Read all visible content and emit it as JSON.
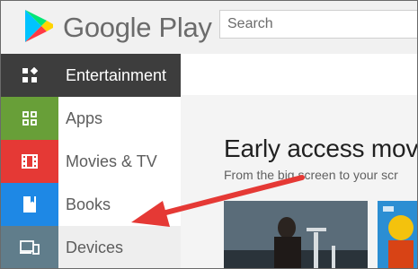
{
  "header": {
    "brand": "Google Play",
    "search_placeholder": "Search"
  },
  "sidebar": {
    "items": [
      {
        "label": "Entertainment",
        "icon": "grid-icon",
        "selected": true
      },
      {
        "label": "Apps",
        "icon": "apps-grid-icon",
        "color": "#689f38"
      },
      {
        "label": "Movies & TV",
        "icon": "film-icon",
        "color": "#e53935"
      },
      {
        "label": "Books",
        "icon": "book-icon",
        "color": "#1e88e5"
      },
      {
        "label": "Devices",
        "icon": "devices-icon",
        "color": "#607d8b"
      }
    ]
  },
  "main": {
    "title": "Early access mov",
    "subtitle": "From the big screen to your scr",
    "cards": [
      {
        "icon": "movie-poster"
      },
      {
        "icon": "movie-poster"
      }
    ]
  },
  "annotation": {
    "color": "#e53935",
    "icon": "arrow-pointer"
  }
}
